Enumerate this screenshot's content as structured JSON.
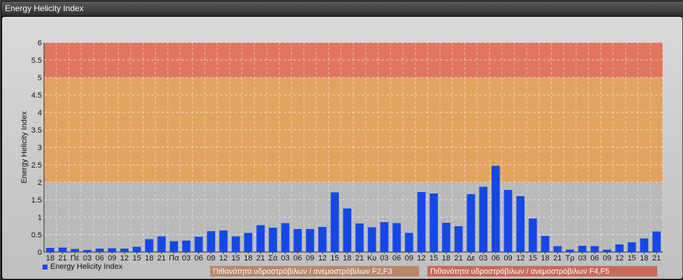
{
  "window": {
    "title": "Energy Helicity Index"
  },
  "legend": {
    "series_label": "Energy Helicity Index"
  },
  "bands": [
    {
      "label": "Πιθανότητα υδροστρόβιλων / ανεμοστρόβιλων F2,F3",
      "from": 2,
      "to": 5,
      "color": "#e8a050",
      "legend_color": "#b9876a"
    },
    {
      "label": "Πιθανότητα υδροστρόβιλων / ανεμοστρόβιλων F4,F5",
      "from": 5,
      "to": 6,
      "color": "#e86a50",
      "legend_color": "#c96a58"
    }
  ],
  "chart_data": {
    "type": "bar",
    "title": "",
    "xlabel": "",
    "ylabel": "Energy Helicity Index",
    "ylim": [
      0,
      6
    ],
    "yticks": [
      "0",
      "0.5",
      "1",
      "1.5",
      "2",
      "2.5",
      "3",
      "3.5",
      "4",
      "4.5",
      "5",
      "5.5",
      "6"
    ],
    "categories": [
      "18",
      "21",
      "Πέ",
      "03",
      "06",
      "09",
      "12",
      "15",
      "18",
      "21",
      "Πα",
      "03",
      "06",
      "09",
      "12",
      "15",
      "18",
      "21",
      "Σά",
      "03",
      "06",
      "09",
      "12",
      "15",
      "18",
      "21",
      "Κυ",
      "03",
      "06",
      "09",
      "12",
      "15",
      "18",
      "21",
      "Δε",
      "03",
      "06",
      "09",
      "12",
      "15",
      "18",
      "21",
      "Τρ",
      "03",
      "06",
      "09",
      "12",
      "15",
      "18",
      "21"
    ],
    "series": [
      {
        "name": "Energy Helicity Index",
        "color": "#1448e6",
        "values": [
          0.12,
          0.13,
          0.09,
          0.06,
          0.1,
          0.11,
          0.1,
          0.15,
          0.37,
          0.45,
          0.31,
          0.33,
          0.44,
          0.6,
          0.62,
          0.45,
          0.55,
          0.77,
          0.7,
          0.83,
          0.66,
          0.66,
          0.72,
          1.71,
          1.25,
          0.82,
          0.71,
          0.86,
          0.83,
          0.55,
          1.72,
          1.68,
          0.84,
          0.74,
          1.66,
          1.87,
          2.47,
          1.78,
          1.6,
          0.96,
          0.46,
          0.17,
          0.07,
          0.18,
          0.17,
          0.07,
          0.22,
          0.28,
          0.39,
          0.59
        ]
      }
    ]
  }
}
